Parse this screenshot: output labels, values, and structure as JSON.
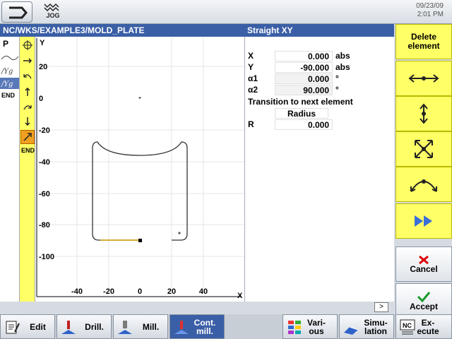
{
  "header": {
    "jog_label": "JOG",
    "date": "09/23/09",
    "time": "2:01 PM"
  },
  "path": "NC/WKS/EXAMPLE3/MOLD_PLATE",
  "element_title": "Straight XY",
  "left_panel": {
    "program_label": "P",
    "end_label": "END"
  },
  "element_bar": {
    "end_label": "END"
  },
  "plot": {
    "y_axis_label": "Y",
    "x_axis_label": "X",
    "y_ticks": [
      "20",
      "0",
      "-20",
      "-40",
      "-60",
      "-80",
      "-100"
    ],
    "x_ticks": [
      "-40",
      "-20",
      "0",
      "20",
      "40"
    ]
  },
  "form": {
    "rows": [
      {
        "label": "X",
        "value": "0.000",
        "unit": "abs"
      },
      {
        "label": "Y",
        "value": "-90.000",
        "unit": "abs"
      },
      {
        "label": "α1",
        "value": "0.000",
        "unit": "°"
      },
      {
        "label": "α2",
        "value": "90.000",
        "unit": "°"
      }
    ],
    "transition_label": "Transition to next element",
    "transition_type": "Radius",
    "r_label": "R",
    "r_value": "0.000"
  },
  "right_softkeys": {
    "delete": "Delete element",
    "cancel": "Cancel",
    "accept": "Accept"
  },
  "more_button": ">",
  "bottom_softkeys": [
    {
      "label": "Edit"
    },
    {
      "label": "Drill."
    },
    {
      "label": "Mill."
    },
    {
      "label": "Cont. mill."
    },
    {
      "label": "Vari- ous"
    },
    {
      "label": "Simu- lation"
    },
    {
      "label": "Ex- ecute"
    }
  ],
  "colors": {
    "accent_blue": "#3a5fa6",
    "softkey_yellow": "#ffff66",
    "selected_orange": "#f0a020"
  }
}
